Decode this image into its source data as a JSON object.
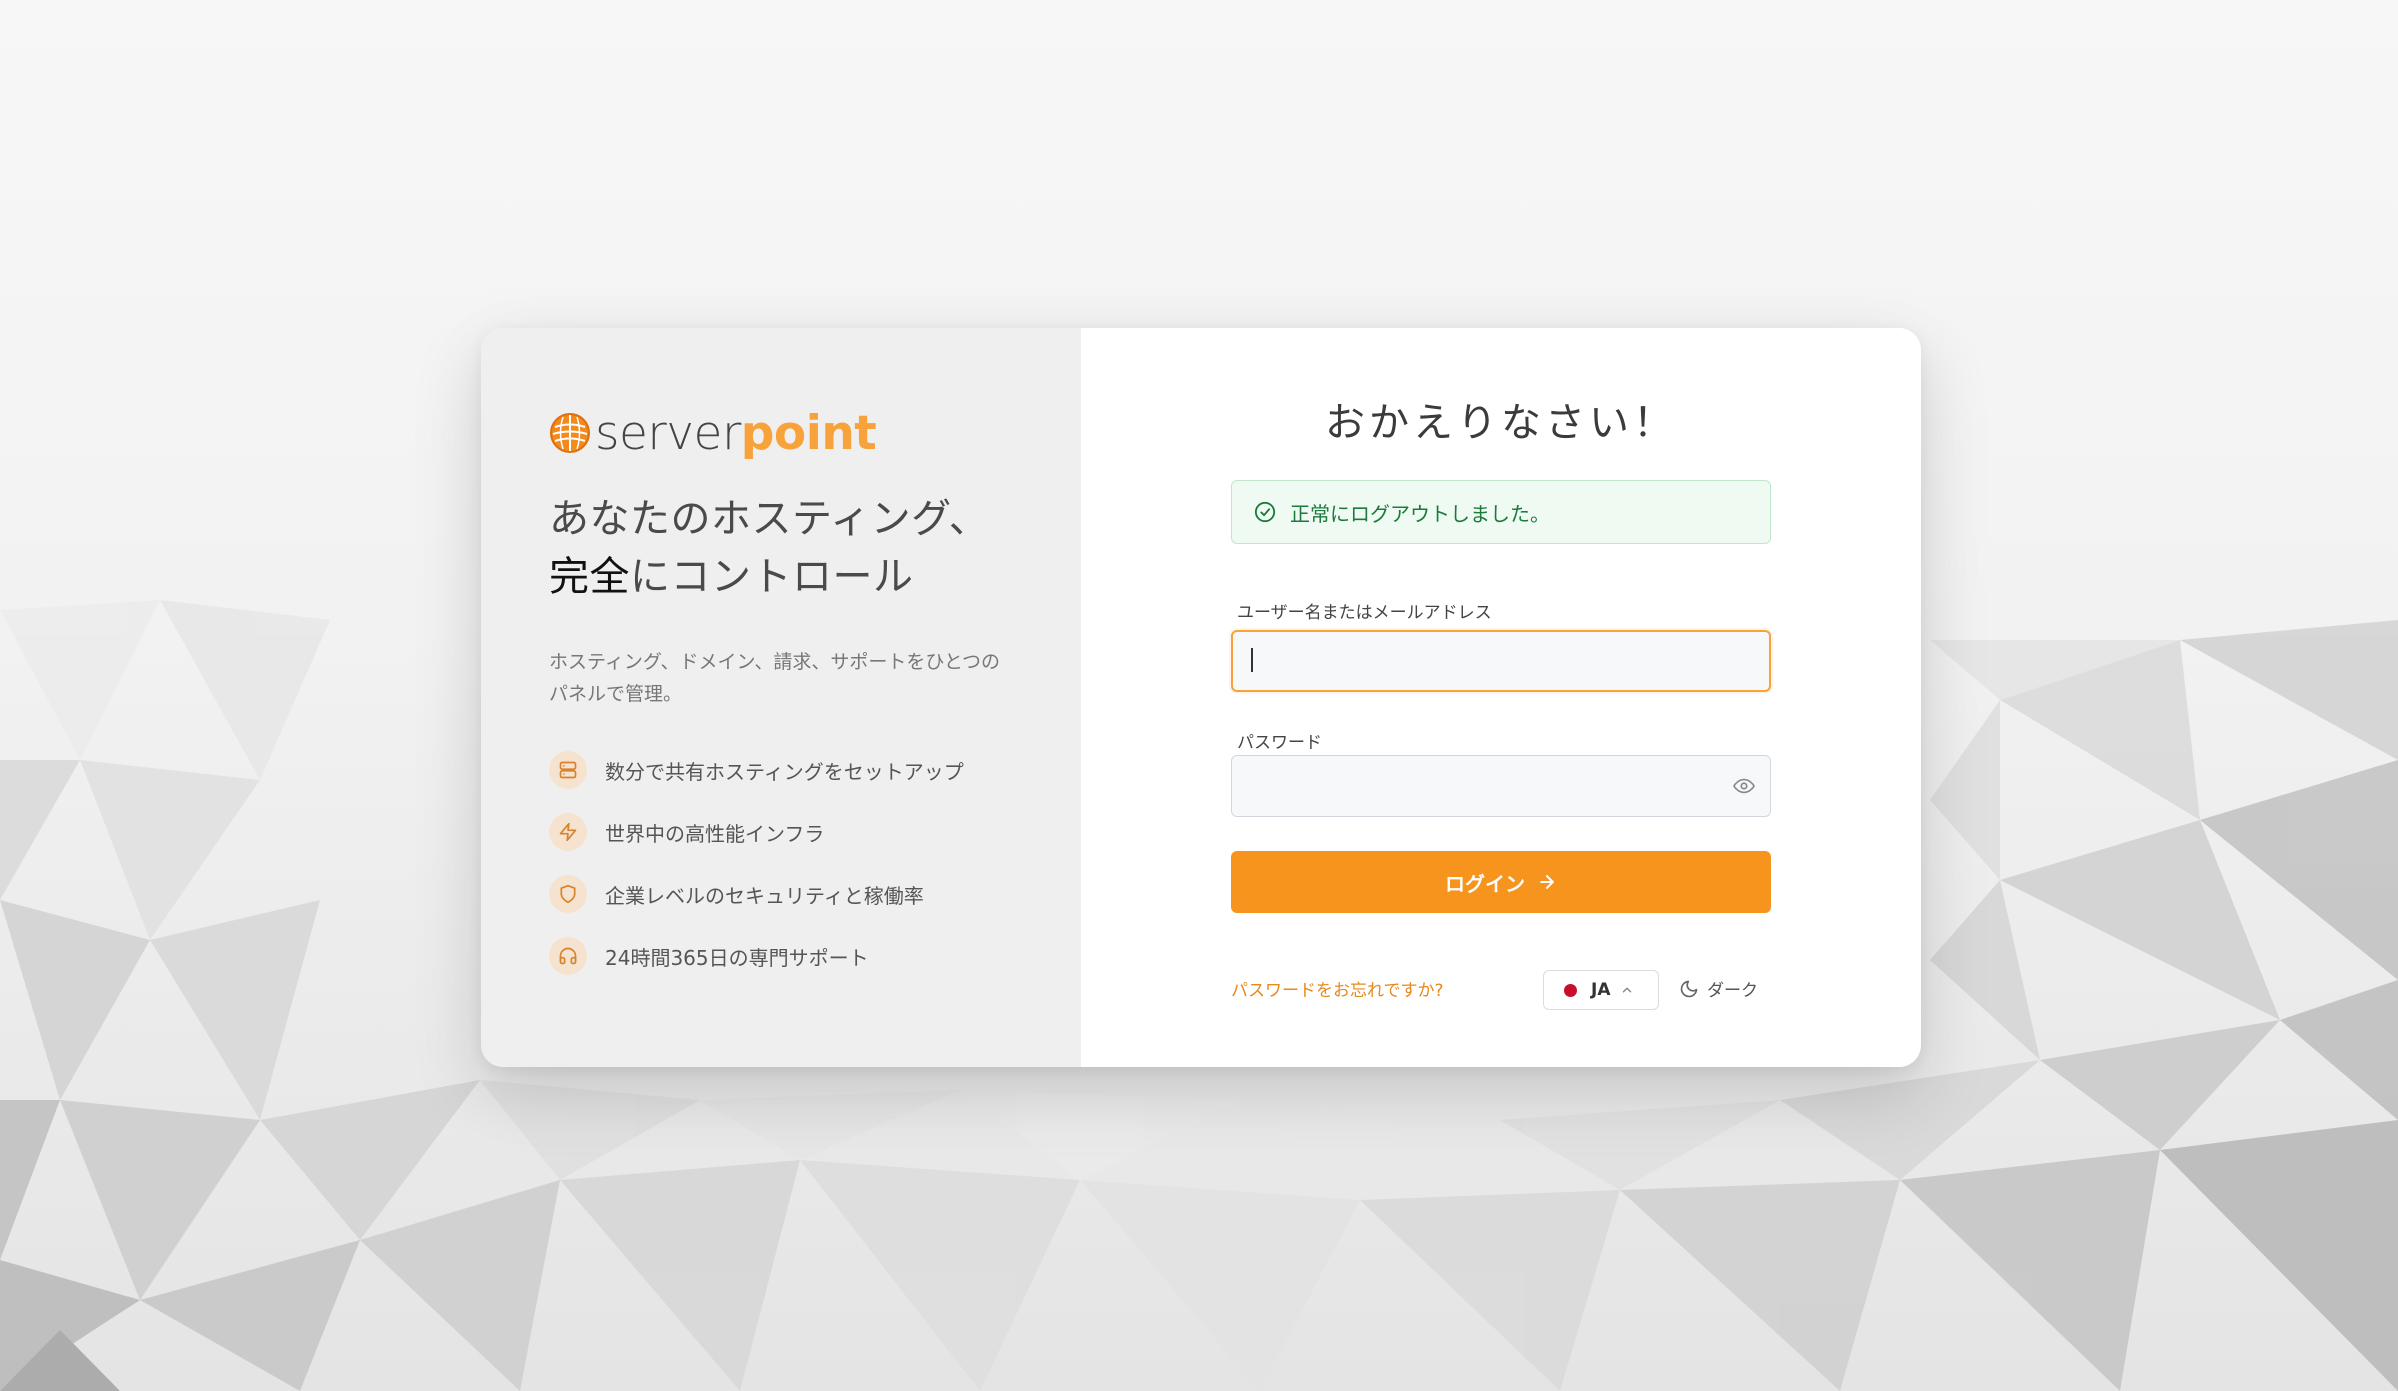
{
  "brand": {
    "name_part1": "server",
    "name_part2": "point",
    "accent_color": "#f7a23b",
    "button_color": "#f7941d"
  },
  "left_panel": {
    "headline_line1": "あなたのホスティング、",
    "headline_em": "完全",
    "headline_line2_rest": "にコントロール",
    "subtext": "ホスティング、ドメイン、請求、サポートをひとつのパネルで管理。",
    "features": [
      {
        "icon": "server-icon",
        "label": "数分で共有ホスティングをセットアップ"
      },
      {
        "icon": "lightning-icon",
        "label": "世界中の高性能インフラ"
      },
      {
        "icon": "shield-icon",
        "label": "企業レベルのセキュリティと稼働率"
      },
      {
        "icon": "headphones-icon",
        "label": "24時間365日の専門サポート"
      }
    ]
  },
  "login": {
    "title": "おかえりなさい！",
    "alert_text": "正常にログアウトしました。",
    "username_label": "ユーザー名またはメールアドレス",
    "username_value": "",
    "password_label": "パスワード",
    "password_value": "",
    "submit_label": "ログイン",
    "forgot_label": "パスワードをお忘れですか?",
    "language_code": "JA",
    "theme_label": "ダーク"
  }
}
